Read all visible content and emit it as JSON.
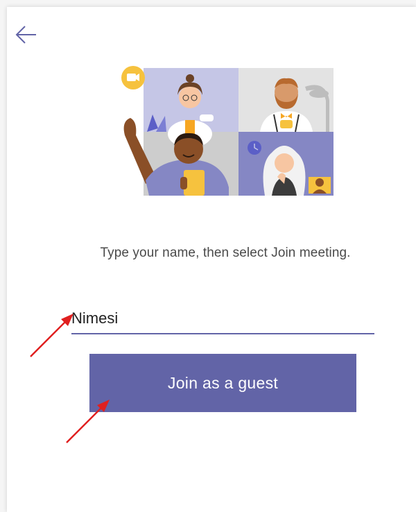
{
  "page": {
    "instruction": "Type your name, then select Join meeting."
  },
  "name_field": {
    "value": "Nimesi",
    "placeholder": ""
  },
  "join_button": {
    "label": "Join as a guest"
  },
  "icons": {
    "back": "back-arrow-icon",
    "video": "video-camera-icon",
    "clock": "clock-icon"
  },
  "colors": {
    "accent": "#6264a7",
    "annotation": "#e02020"
  }
}
